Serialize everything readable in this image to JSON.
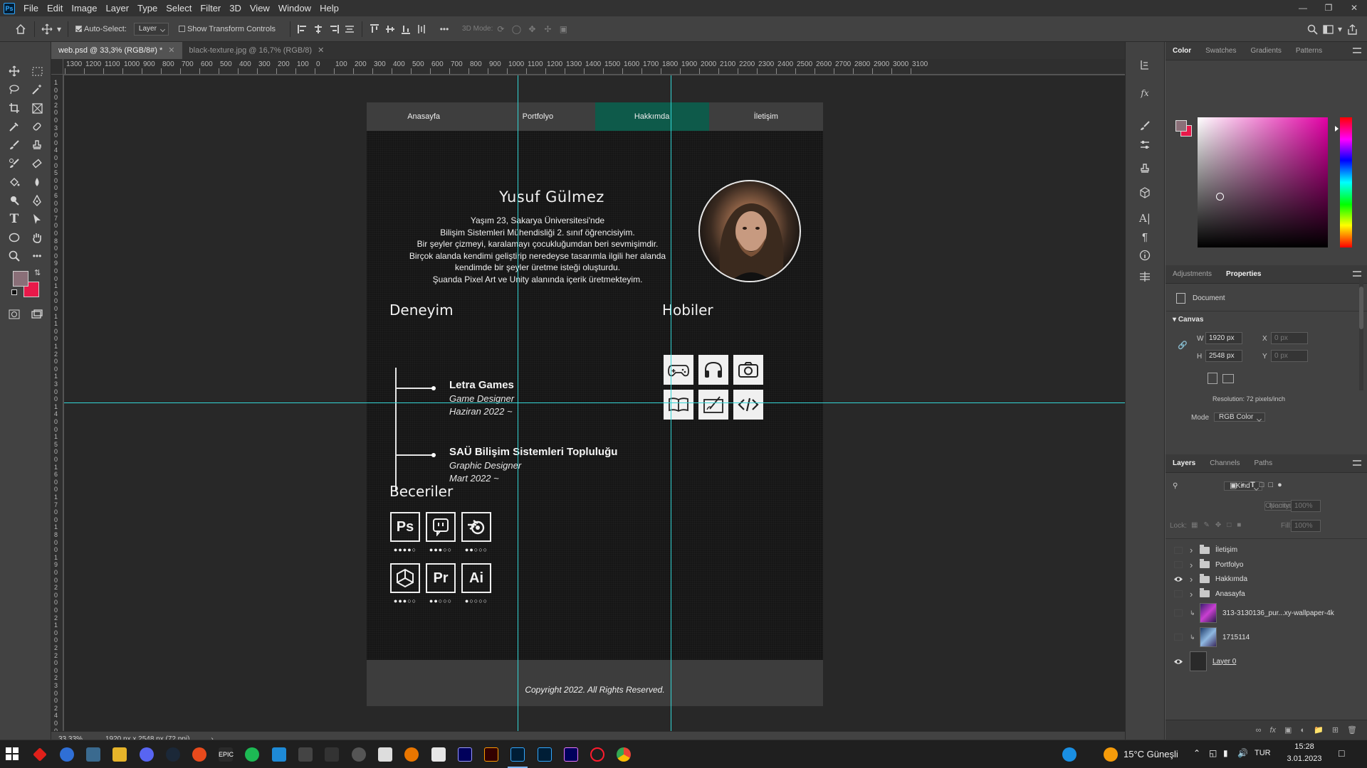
{
  "app": {
    "logo": "Ps",
    "menu": [
      "File",
      "Edit",
      "Image",
      "Layer",
      "Type",
      "Select",
      "Filter",
      "3D",
      "View",
      "Window",
      "Help"
    ]
  },
  "options": {
    "auto_select_label": "Auto-Select:",
    "auto_select_value": "Layer",
    "show_transform_label": "Show Transform Controls",
    "mode_3d_label": "3D Mode:"
  },
  "tabs": [
    {
      "label": "web.psd @ 33,3% (RGB/8#) *",
      "active": true
    },
    {
      "label": "black-texture.jpg @ 16,7% (RGB/8)",
      "active": false
    }
  ],
  "ruler_h": [
    "1300",
    "1200",
    "1100",
    "1000",
    "900",
    "800",
    "700",
    "600",
    "500",
    "400",
    "300",
    "200",
    "100",
    "0",
    "100",
    "200",
    "300",
    "400",
    "500",
    "600",
    "700",
    "800",
    "900",
    "1000",
    "1100",
    "1200",
    "1300",
    "1400",
    "1500",
    "1600",
    "1700",
    "1800",
    "1900",
    "2000",
    "2100",
    "2200",
    "2300",
    "2400",
    "2500",
    "2600",
    "2700",
    "2800",
    "2900",
    "3000",
    "3100"
  ],
  "ruler_v": [
    "1",
    "0",
    "0",
    "2",
    "0",
    "0",
    "3",
    "0",
    "0",
    "4",
    "0",
    "0",
    "5",
    "0",
    "0",
    "6",
    "0",
    "0",
    "7",
    "0",
    "0",
    "8",
    "0",
    "0",
    "9",
    "0",
    "0",
    "1",
    "0",
    "0",
    "0",
    "1",
    "1",
    "0",
    "0",
    "1",
    "2",
    "0",
    "0",
    "1",
    "3",
    "0",
    "0",
    "1",
    "4",
    "0",
    "0",
    "1",
    "5",
    "0",
    "0",
    "1",
    "6",
    "0",
    "0",
    "1",
    "7",
    "0",
    "0",
    "1",
    "8",
    "0",
    "0",
    "1",
    "9",
    "0",
    "0",
    "2",
    "0",
    "0",
    "0",
    "2",
    "1",
    "0",
    "0",
    "2",
    "2",
    "0",
    "0",
    "2",
    "3",
    "0",
    "0",
    "2",
    "4",
    "0",
    "0"
  ],
  "site": {
    "nav": [
      "Anasayfa",
      "Portfolyo",
      "Hakkımda",
      "İletişim"
    ],
    "nav_active": 2,
    "name": "Yusuf Gülmez",
    "bio": [
      "Yaşım 23, Sakarya Üniversitesi'nde",
      "Bilişim Sistemleri Mühendisliği 2. sınıf öğrencisiyim.",
      "Bir şeyler çizmeyi, karalamayı çocukluğumdan beri sevmişimdir.",
      "Birçok alanda kendimi geliştirip neredeyse tasarımla ilgili her alanda",
      "kendimde bir şeyler üretme isteği oluşturdu.",
      "Şuanda Pixel Art ve Unity alanında içerik üretmekteyim."
    ],
    "experience_title": "Deneyim",
    "experience": [
      {
        "company": "Letra Games",
        "role": "Game Designer",
        "date": "Haziran 2022 ~"
      },
      {
        "company": "SAÜ Bilişim Sistemleri Topluluğu",
        "role": "Graphic Designer",
        "date": "Mart 2022 ~"
      }
    ],
    "hobbies_title": "Hobiler",
    "hobbies": [
      "gamepad-icon",
      "headphones-icon",
      "camera-icon",
      "book-icon",
      "drawing-tablet-icon",
      "code-icon"
    ],
    "skills_title": "Beceriler",
    "skills": [
      {
        "label": "Ps",
        "icon": "photoshop-icon",
        "level": 4
      },
      {
        "label": "",
        "icon": "twitch-icon",
        "level": 3
      },
      {
        "label": "",
        "icon": "blender-icon",
        "level": 2
      },
      {
        "label": "",
        "icon": "unity-icon",
        "level": 3
      },
      {
        "label": "Pr",
        "icon": "premiere-icon",
        "level": 2
      },
      {
        "label": "Ai",
        "icon": "illustrator-icon",
        "level": 1
      }
    ],
    "copyright": "Copyright 2022. All Rights Reserved."
  },
  "status": {
    "zoom": "33,33%",
    "doc_info": "1920 px x 2548 px (72 ppi)"
  },
  "color_panel": {
    "tabs": [
      "Color",
      "Swatches",
      "Gradients",
      "Patterns"
    ],
    "fg": "#8a6f78",
    "bg": "#e8194a"
  },
  "properties_panel": {
    "tabs": [
      "Adjustments",
      "Properties"
    ],
    "doc_label": "Document",
    "canvas_label": "Canvas",
    "w_label": "W",
    "w_value": "1920 px",
    "h_label": "H",
    "h_value": "2548 px",
    "x_label": "X",
    "x_value": "0 px",
    "y_label": "Y",
    "y_value": "0 px",
    "resolution": "Resolution: 72 pixels/inch",
    "mode_label": "Mode",
    "mode_value": "RGB Color"
  },
  "layers_panel": {
    "tabs": [
      "Layers",
      "Channels",
      "Paths"
    ],
    "kind": "Kind",
    "blend": "Normal",
    "opacity_label": "Opacity:",
    "opacity": "100%",
    "lock_label": "Lock:",
    "fill_label": "Fill:",
    "fill": "100%",
    "layers": [
      {
        "name": "İletişim",
        "type": "group",
        "visible": false
      },
      {
        "name": "Portfolyo",
        "type": "group",
        "visible": false
      },
      {
        "name": "Hakkımda",
        "type": "group",
        "visible": true
      },
      {
        "name": "Anasayfa",
        "type": "group",
        "visible": false
      },
      {
        "name": "313-3130136_pur...xy-wallpaper-4k",
        "type": "smart",
        "visible": false
      },
      {
        "name": "1715114",
        "type": "smart",
        "visible": false
      },
      {
        "name": "Layer 0",
        "type": "layer",
        "visible": true
      }
    ]
  },
  "taskbar": {
    "weather": "15°C Güneşli",
    "lang": "TUR",
    "time": "15:28",
    "date": "3.01.2023"
  }
}
